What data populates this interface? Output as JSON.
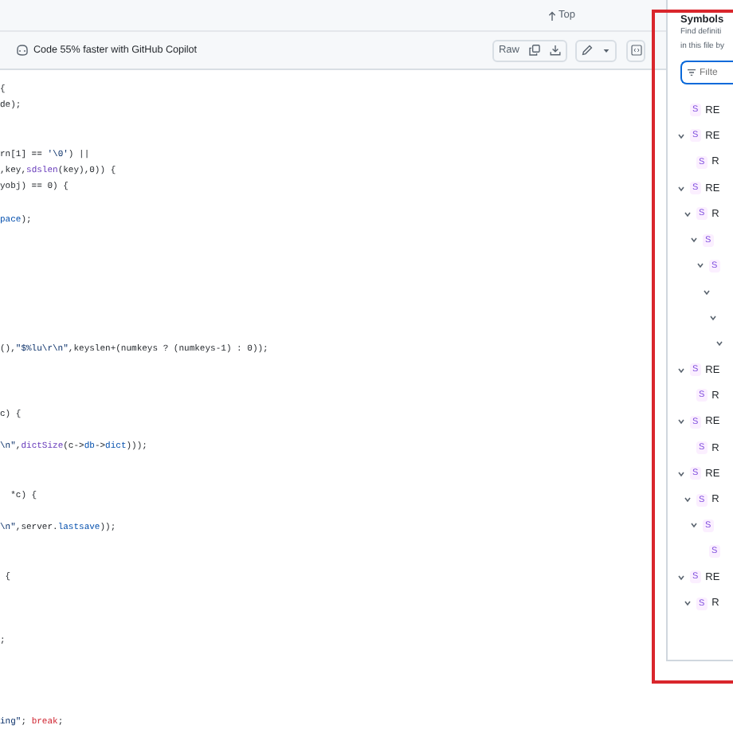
{
  "top_bar": {
    "top_link": "Top"
  },
  "toolbar": {
    "copilot_text": "Code 55% faster with GitHub Copilot",
    "raw_button": "Raw"
  },
  "code_lines": [
    {
      "kind": "code",
      "segments": [
        {
          "kind": "plain",
          "text": "{"
        }
      ]
    },
    {
      "kind": "code",
      "segments": [
        {
          "kind": "plain",
          "text": "de);"
        }
      ]
    },
    {
      "kind": "blank"
    },
    {
      "kind": "blank"
    },
    {
      "kind": "code",
      "segments": [
        {
          "kind": "plain",
          "text": "rn[1] == "
        },
        {
          "kind": "string",
          "text": "'\\0'"
        },
        {
          "kind": "plain",
          "text": ") ||"
        }
      ]
    },
    {
      "kind": "code",
      "segments": [
        {
          "kind": "plain",
          "text": ",key,"
        },
        {
          "kind": "func",
          "text": "sdslen"
        },
        {
          "kind": "plain",
          "text": "(key),0)) {"
        }
      ]
    },
    {
      "kind": "code",
      "segments": [
        {
          "kind": "plain",
          "text": "yobj) == 0) {"
        }
      ]
    },
    {
      "kind": "blank"
    },
    {
      "kind": "code",
      "segments": [
        {
          "kind": "const",
          "text": "pace"
        },
        {
          "kind": "plain",
          "text": ");"
        }
      ]
    },
    {
      "kind": "blank"
    },
    {
      "kind": "blank"
    },
    {
      "kind": "blank"
    },
    {
      "kind": "blank"
    },
    {
      "kind": "blank"
    },
    {
      "kind": "blank"
    },
    {
      "kind": "blank"
    },
    {
      "kind": "code",
      "segments": [
        {
          "kind": "plain",
          "text": "(),"
        },
        {
          "kind": "string",
          "text": "\"$%lu\\r\\n\""
        },
        {
          "kind": "plain",
          "text": ",keyslen+(numkeys ? (numkeys-1) : 0));"
        }
      ]
    },
    {
      "kind": "blank"
    },
    {
      "kind": "blank"
    },
    {
      "kind": "blank"
    },
    {
      "kind": "code",
      "segments": [
        {
          "kind": "plain",
          "text": "c) {"
        }
      ]
    },
    {
      "kind": "blank"
    },
    {
      "kind": "code",
      "segments": [
        {
          "kind": "string",
          "text": "\\n\""
        },
        {
          "kind": "plain",
          "text": ","
        },
        {
          "kind": "func",
          "text": "dictSize"
        },
        {
          "kind": "plain",
          "text": "(c->"
        },
        {
          "kind": "const",
          "text": "db"
        },
        {
          "kind": "plain",
          "text": "->"
        },
        {
          "kind": "const",
          "text": "dict"
        },
        {
          "kind": "plain",
          "text": ")));"
        }
      ]
    },
    {
      "kind": "blank"
    },
    {
      "kind": "blank"
    },
    {
      "kind": "code",
      "segments": [
        {
          "kind": "plain",
          "text": "  *c) {"
        }
      ]
    },
    {
      "kind": "blank"
    },
    {
      "kind": "code",
      "segments": [
        {
          "kind": "string",
          "text": "\\n\""
        },
        {
          "kind": "plain",
          "text": ",server."
        },
        {
          "kind": "const",
          "text": "lastsave"
        },
        {
          "kind": "plain",
          "text": "));"
        }
      ]
    },
    {
      "kind": "blank"
    },
    {
      "kind": "blank"
    },
    {
      "kind": "code",
      "segments": [
        {
          "kind": "plain",
          "text": " {"
        }
      ]
    },
    {
      "kind": "blank"
    },
    {
      "kind": "blank"
    },
    {
      "kind": "blank"
    },
    {
      "kind": "code",
      "segments": [
        {
          "kind": "plain",
          "text": ";"
        }
      ]
    },
    {
      "kind": "blank"
    },
    {
      "kind": "blank"
    },
    {
      "kind": "blank"
    },
    {
      "kind": "blank"
    },
    {
      "kind": "code",
      "segments": [
        {
          "kind": "string",
          "text": "ing\""
        },
        {
          "kind": "plain",
          "text": "; "
        },
        {
          "kind": "keyword",
          "text": "break"
        },
        {
          "kind": "plain",
          "text": ";"
        }
      ]
    }
  ],
  "symbols": {
    "title": "Symbols",
    "description_lines": [
      "Find definiti",
      "in this file by"
    ],
    "filter": {
      "placeholder": "Filte"
    },
    "items": [
      {
        "badge": "S",
        "label": "RE"
      },
      {
        "badge": "S",
        "label": "RE",
        "expanded": true,
        "children": [
          {
            "badge": "S",
            "label": "R"
          }
        ]
      },
      {
        "badge": "S",
        "label": "RE",
        "expanded": true,
        "children": [
          {
            "badge": "S",
            "label": "R",
            "expanded": true,
            "children": [
              {
                "badge": "S",
                "expanded": true,
                "children": [
                  {
                    "badge": "S",
                    "expanded": true,
                    "children": [
                      {
                        "expanded": true,
                        "children": [
                          {
                            "expanded": true,
                            "children": [
                              {
                                "expanded": true
                              }
                            ]
                          }
                        ]
                      }
                    ]
                  }
                ]
              }
            ]
          }
        ]
      },
      {
        "badge": "S",
        "label": "RE",
        "expanded": true,
        "children": [
          {
            "badge": "S",
            "label": "R"
          }
        ]
      },
      {
        "badge": "S",
        "label": "RE",
        "expanded": true,
        "children": [
          {
            "badge": "S",
            "label": "R"
          }
        ]
      },
      {
        "badge": "S",
        "label": "RE",
        "expanded": true,
        "children": [
          {
            "badge": "S",
            "label": "R",
            "expanded": true,
            "children": [
              {
                "badge": "S",
                "expanded": true,
                "children": [
                  {
                    "badge": "S"
                  }
                ]
              }
            ]
          }
        ]
      },
      {
        "badge": "S",
        "label": "RE",
        "expanded": true,
        "children": [
          {
            "badge": "S",
            "label": "R",
            "expanded": true
          }
        ]
      }
    ]
  }
}
